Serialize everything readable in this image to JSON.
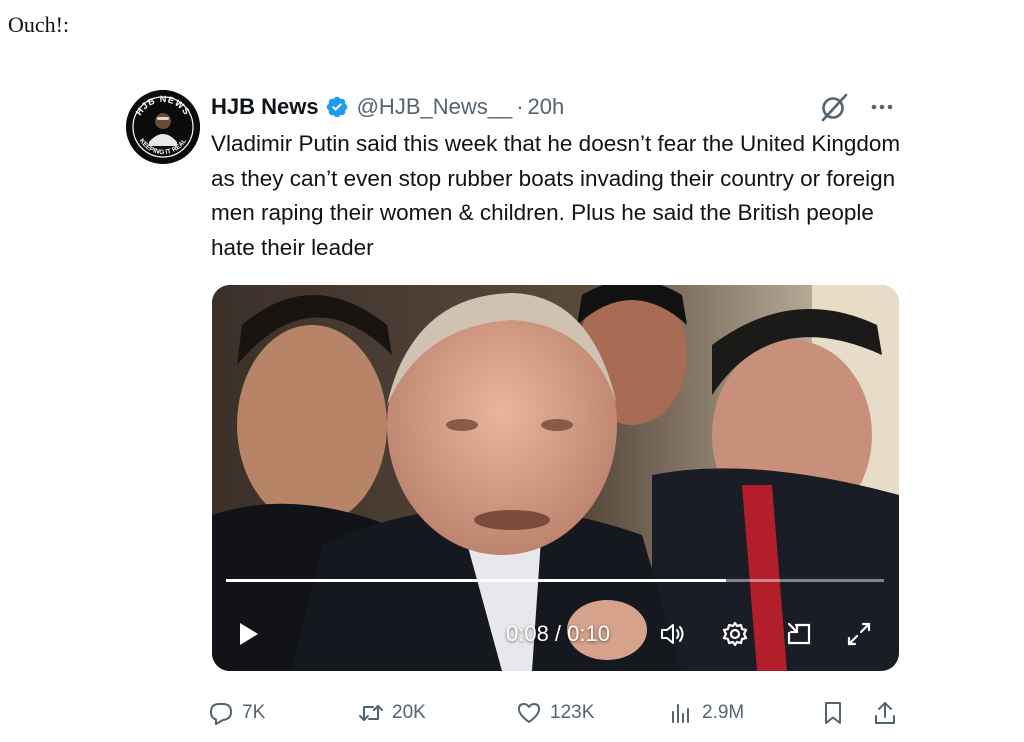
{
  "intro_text": "Ouch!:",
  "tweet": {
    "author": {
      "name": "HJB News",
      "handle": "@HJB_News__",
      "verified": true,
      "avatar_text_top": "HJB NEWS",
      "avatar_text_bottom": "KEEPING IT REAL"
    },
    "time_separator": "·",
    "timestamp": "20h",
    "text": "Vladimir Putin said this week that he doesn’t fear the United Kingdom as they can’t even stop rubber boats invading their country or foreign men raping their women & children. Plus he said the British people hate their leader",
    "icons": {
      "grok": "grok-icon",
      "more": "more-icon"
    },
    "video": {
      "time_display": "0:08 / 0:10",
      "progress": 0.76,
      "controls": [
        "play-icon",
        "volume-icon",
        "settings-icon",
        "pip-icon",
        "fullscreen-icon"
      ]
    },
    "metrics": {
      "replies": "7K",
      "reposts": "20K",
      "likes": "123K",
      "views": "2.9M"
    }
  },
  "colors": {
    "text": "#0f1419",
    "secondary": "#536471",
    "verified_blue": "#1d9bf0"
  }
}
